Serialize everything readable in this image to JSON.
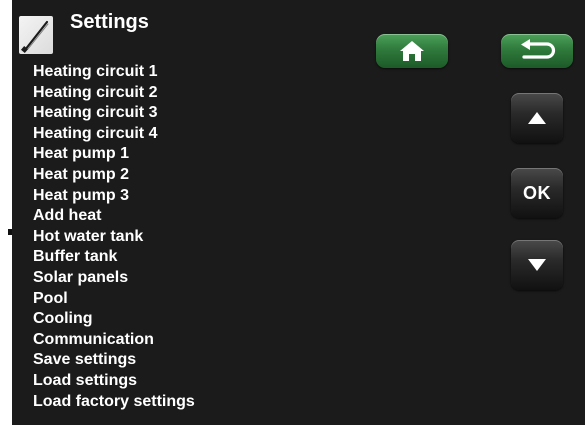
{
  "header": {
    "title": "Settings",
    "icon": "wrench-icon"
  },
  "menu": {
    "items": [
      "Heating circuit 1",
      "Heating circuit 2",
      "Heating circuit 3",
      "Heating circuit 4",
      "Heat pump 1",
      "Heat pump 2",
      "Heat pump 3",
      "Add heat",
      "Hot water tank",
      "Buffer tank",
      "Solar panels",
      "Pool",
      "Cooling",
      "Communication",
      "Save settings",
      "Load settings",
      "Load factory settings"
    ]
  },
  "controls": {
    "home_icon": "home-icon",
    "back_icon": "back-arrow-icon",
    "up_icon": "arrow-up-icon",
    "ok_label": "OK",
    "down_icon": "arrow-down-icon"
  },
  "colors": {
    "background": "#1b1b1b",
    "text": "#ffffff",
    "green_button": "#2f7a3c",
    "dark_button": "#2a2a2a"
  }
}
